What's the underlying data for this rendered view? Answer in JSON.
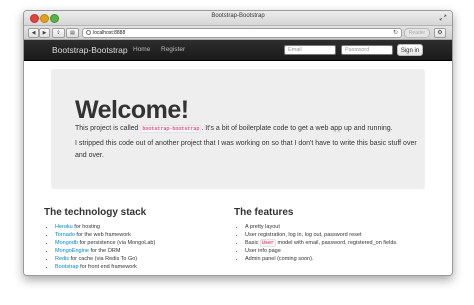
{
  "window": {
    "title": "Bootstrap-Bootstrap"
  },
  "browser": {
    "url": "localhost:8888",
    "reader_label": "Reader",
    "reload_glyph": "↻",
    "icons": [
      "back-icon",
      "forward-icon",
      "reload-icon",
      "gear-icon",
      "globe-icon"
    ]
  },
  "navbar": {
    "brand": "Bootstrap-Bootstrap",
    "links": [
      "Home",
      "Register"
    ],
    "email_placeholder": "Email",
    "password_placeholder": "Password",
    "signin_label": "Sign in"
  },
  "hero": {
    "heading": "Welcome!",
    "p1_before": "This project is called ",
    "p1_code": "bootstrap-bootstrap",
    "p1_after": ". It's a bit of boilerplate code to get a web app up and running.",
    "p2": "I stripped this code out of another project that I was working on so that I don't have to write this basic stuff over and over."
  },
  "tech": {
    "title": "The technology stack",
    "items": [
      {
        "name": "Heroku",
        "desc": " for hosting"
      },
      {
        "name": "Tornado",
        "desc": " for the web framework"
      },
      {
        "name": "Mongodb",
        "desc": " for persistence (via MongoLab)"
      },
      {
        "name": "MongoEngine",
        "desc": " for the ORM"
      },
      {
        "name": "Redis",
        "desc": " for cache (via Redis To Go)"
      },
      {
        "name": "Bootstrap",
        "desc": " for front end framework"
      }
    ]
  },
  "features": {
    "title": "The features",
    "items": [
      {
        "text": "A pretty layout"
      },
      {
        "text": "User registration, log in, log out, password reset"
      },
      {
        "before": "Basic ",
        "code": "User",
        "after": " model with email, password, registered_on fields."
      },
      {
        "text": "User info page"
      },
      {
        "text": "Admin panel (coming soon)."
      }
    ]
  },
  "colors": {
    "navbar": "#1f1f1f",
    "hero_bg": "#eeeeee",
    "link": "#0088cc",
    "code": "#dd1144"
  }
}
